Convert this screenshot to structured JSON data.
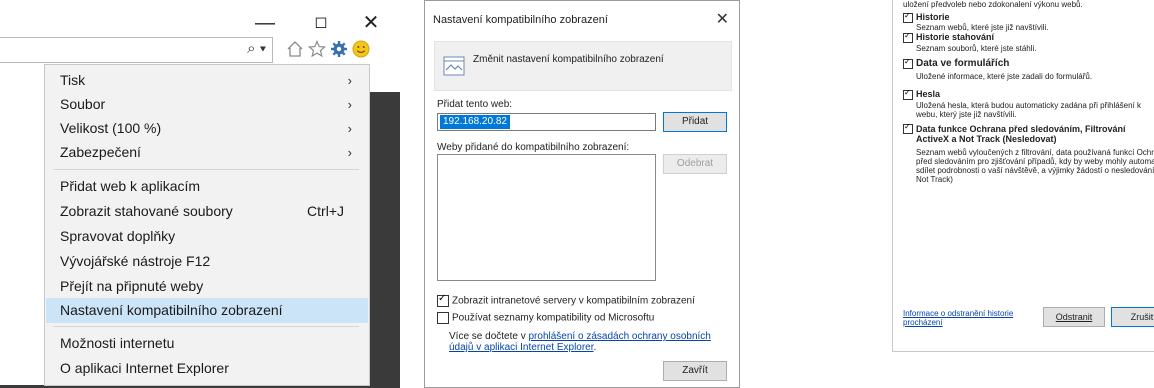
{
  "ie_window": {
    "window_controls": {
      "minimize": "—",
      "restore": "◻",
      "close": "✕"
    },
    "address_bar": {
      "search_dropdown": "⌕ ▾"
    },
    "toolbar_icons": [
      "home-icon",
      "favorites-star-icon",
      "tools-gear-icon",
      "feedback-smiley-icon"
    ]
  },
  "tools_menu": {
    "items": [
      {
        "label": "Tisk",
        "arrow": "›"
      },
      {
        "label": "Soubor",
        "arrow": "›"
      },
      {
        "label": "Velikost (100 %)",
        "arrow": "›"
      },
      {
        "label": "Zabezpečení",
        "arrow": "›"
      },
      {
        "label": "Přidat web k aplikacím"
      },
      {
        "label": "Zobrazit stahované soubory",
        "shortcut": "Ctrl+J"
      },
      {
        "label": "Spravovat doplňky"
      },
      {
        "label": "Vývojářské nástroje F12"
      },
      {
        "label": "Přejít na připnuté weby"
      },
      {
        "label": "Nastavení kompatibilního zobrazení",
        "highlighted": true
      },
      {
        "label": "Možnosti internetu"
      },
      {
        "label": "O aplikaci Internet Explorer"
      }
    ]
  },
  "compat_dialog": {
    "title": "Nastavení kompatibilního zobrazení",
    "close": "✕",
    "header": "Změnit nastavení kompatibilního zobrazení",
    "add_label": "Přidat tento web:",
    "add_value": "192.168.20.82",
    "add_button": "Přidat",
    "list_label": "Weby přidané do kompatibilního zobrazení:",
    "remove_button": "Odebrat",
    "check_intranet": "Zobrazit intranetové servery v kompatibilním zobrazení",
    "check_lists": "Používat seznamy kompatibility od Microsoftu",
    "more_prefix": "Více se dočtete v ",
    "more_link": "prohlášení o zásadách ochrany osobních údajů v aplikaci Internet Explorer",
    "more_suffix": ".",
    "close_button": "Zavřít"
  },
  "history_dialog": {
    "top_text": "uložení předvoleb nebo zdokonalení výkonu webů.",
    "items": [
      {
        "title": "Historie",
        "desc": [
          "Seznam webů, které jste již navštívili."
        ]
      },
      {
        "title": "Historie stahování",
        "desc": [
          "Seznam souborů, které jste stáhli."
        ]
      },
      {
        "title": "Data ve formulářích",
        "desc": [
          "Uložené informace, které jste zadali do formulářů."
        ]
      },
      {
        "title": "Hesla",
        "desc": [
          "Uložená hesla, která budou automaticky zadána při přihlášení k",
          "webu, který jste již navštívili."
        ]
      },
      {
        "title": "Data funkce Ochrana před sledováním, Filtrování ActiveX a Not Track (Nesledovat)",
        "desc": [
          "Seznam webů vyloučených z filtrování, data používaná funkcí Ochrana",
          "před sledováním pro zjišťování případů, kdy by weby mohly automatic",
          "sdílet podrobnosti o vaší návštěvě, a výjimky žádostí o nesledování (D",
          "Not Track)"
        ]
      }
    ],
    "info_link": "Informace o odstranění historie procházení",
    "delete_button": "Odstranit",
    "cancel_button": "Zrušit"
  }
}
